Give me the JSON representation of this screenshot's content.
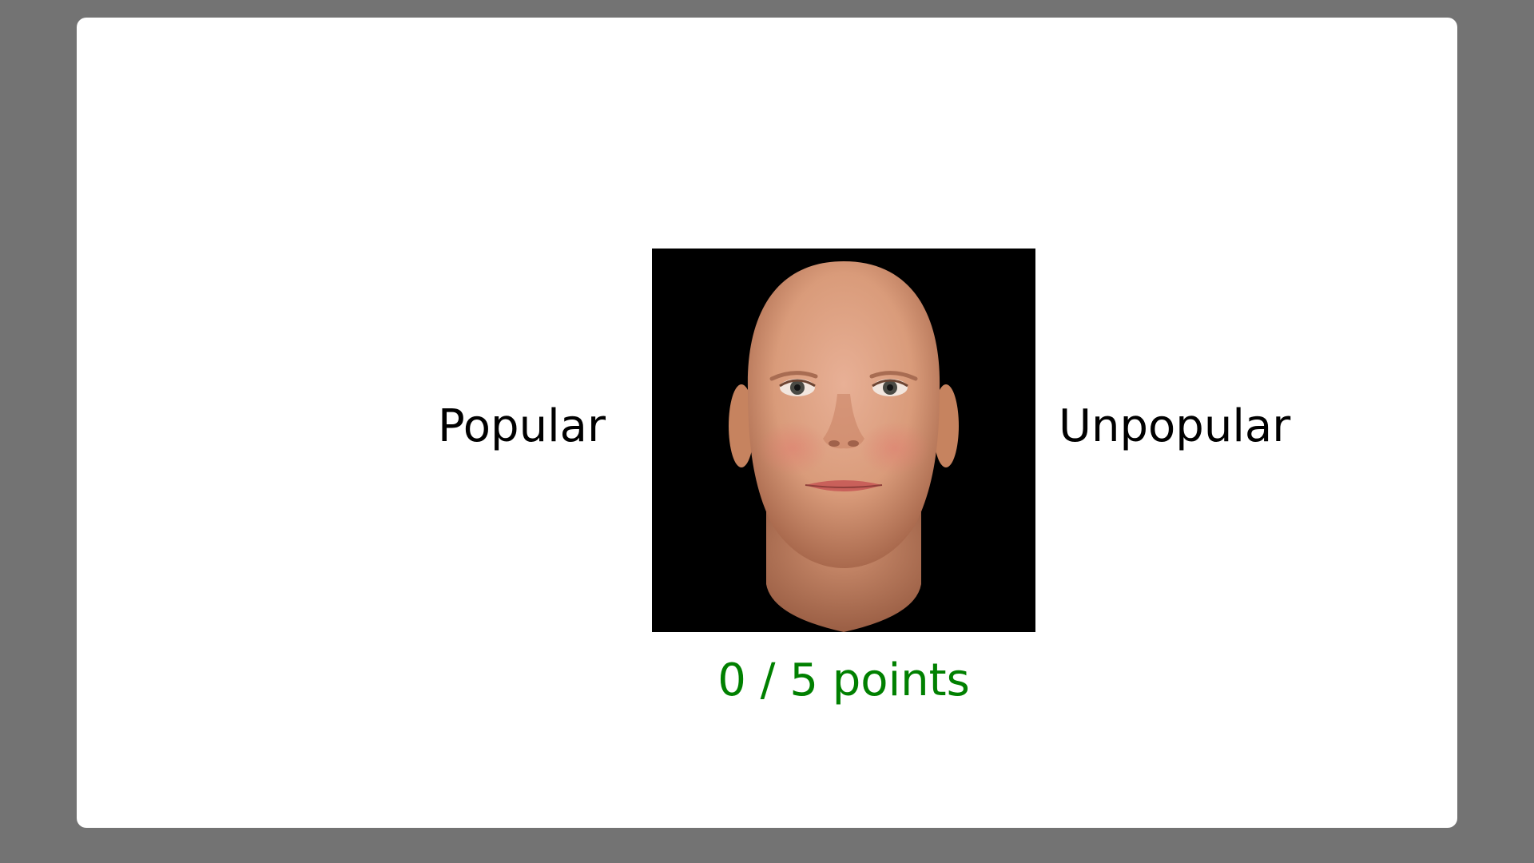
{
  "choices": {
    "left_label": "Popular",
    "right_label": "Unpopular"
  },
  "stimulus": {
    "icon": "face-icon",
    "background_color": "#000000",
    "skin_color": "#d99b7a"
  },
  "feedback": {
    "score_text": "0 / 5 points",
    "score_color": "#008000"
  },
  "colors": {
    "page_background": "#737373",
    "panel_background": "#ffffff"
  }
}
